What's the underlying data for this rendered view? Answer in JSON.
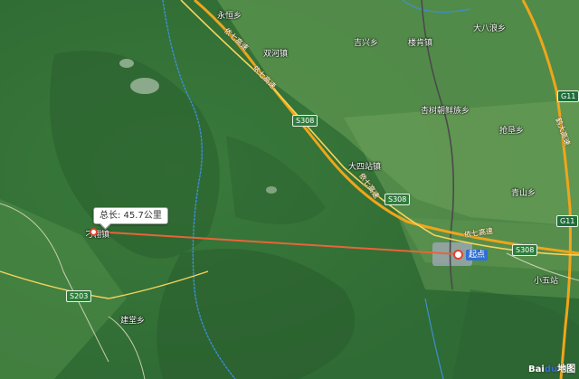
{
  "map": {
    "labels": {
      "yonghengxiang": "永恒乡",
      "shuanghezhen": "双河镇",
      "jixingxiang": "吉兴乡",
      "louxingxiang": "楼肯镇",
      "dabaxiang": "大八浪乡",
      "xingshu": "杏树朝鲜族乡",
      "qiangguan": "抢垦乡",
      "dasizhan": "大四站镇",
      "qingshan": "青山乡",
      "xiaowuzhan": "小五站",
      "diaoxiang": "刁翎镇",
      "jianbao": "建堂乡"
    },
    "shields": {
      "s308_north": "S308",
      "s308_mid": "S308",
      "s308_east": "S308",
      "s203": "S203",
      "g11_north": "G11",
      "g11_south": "G11"
    },
    "highway_labels": {
      "north_a": "依七高速",
      "north_b": "依七高速",
      "mid": "依七高速",
      "east": "依七高速",
      "right_edge": "鹤大高速"
    },
    "measure": {
      "total_label": "总长: 45.7公里",
      "start_label": "起点"
    },
    "watermark": {
      "text": "Bai",
      "paw": "du",
      "suffix": "地图"
    }
  }
}
